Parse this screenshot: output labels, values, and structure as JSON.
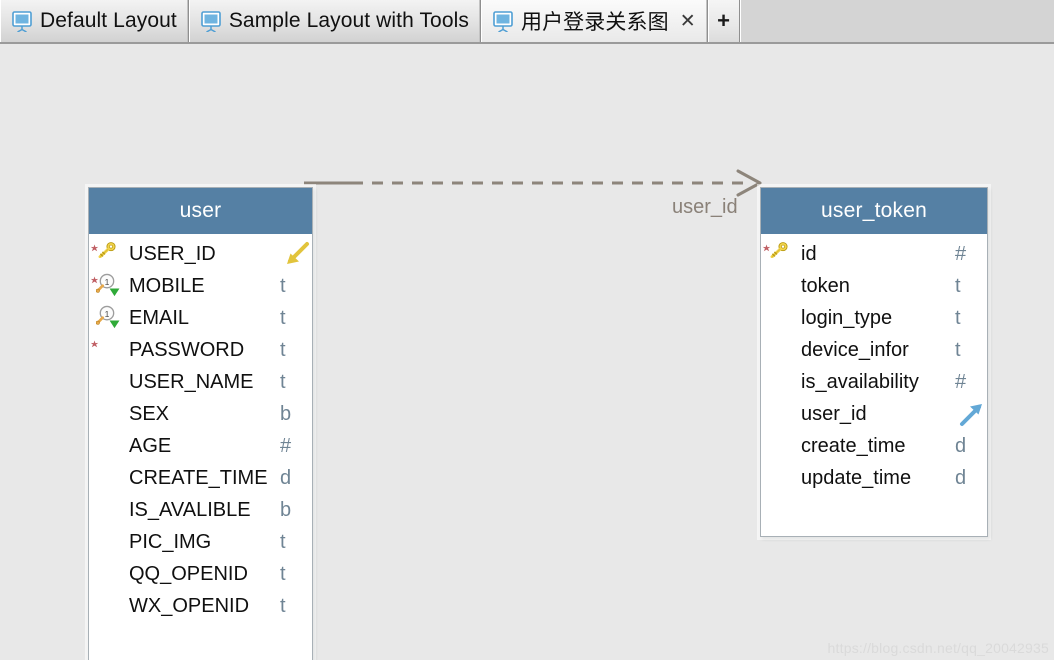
{
  "window": {
    "background_color": "#e8e8e8"
  },
  "tabbar": {
    "background_color": "#d4d4d4",
    "tabs": [
      {
        "label": "Default Layout",
        "icon": "monitor-icon",
        "active": false,
        "closable": false
      },
      {
        "label": "Sample Layout with Tools",
        "icon": "monitor-icon",
        "active": false,
        "closable": false
      },
      {
        "label": "用户登录关系图",
        "icon": "monitor-icon",
        "active": true,
        "closable": true,
        "close_glyph": "✕"
      }
    ],
    "add_tab_label": "+"
  },
  "diagram": {
    "header_color": "#5580a4",
    "body_color": "#ffffff",
    "entities": [
      {
        "name": "user",
        "columns": [
          {
            "name": "USER_ID",
            "type": "",
            "icons": [
              "required-star-icon",
              "primary-key-icon"
            ],
            "end_arrow": "fk-incoming-arrow-icon"
          },
          {
            "name": "MOBILE",
            "type": "t",
            "icons": [
              "required-star-icon",
              "unique-index-icon",
              "index-down-icon"
            ],
            "end_arrow": ""
          },
          {
            "name": "EMAIL",
            "type": "t",
            "icons": [
              "unique-index-icon",
              "index-down-icon"
            ],
            "end_arrow": ""
          },
          {
            "name": "PASSWORD",
            "type": "t",
            "icons": [
              "required-star-icon"
            ],
            "end_arrow": ""
          },
          {
            "name": "USER_NAME",
            "type": "t",
            "icons": [],
            "end_arrow": ""
          },
          {
            "name": "SEX",
            "type": "b",
            "icons": [],
            "end_arrow": ""
          },
          {
            "name": "AGE",
            "type": "#",
            "icons": [],
            "end_arrow": ""
          },
          {
            "name": "CREATE_TIME",
            "type": "d",
            "icons": [],
            "end_arrow": ""
          },
          {
            "name": "IS_AVALIBLE",
            "type": "b",
            "icons": [],
            "end_arrow": ""
          },
          {
            "name": "PIC_IMG",
            "type": "t",
            "icons": [],
            "end_arrow": ""
          },
          {
            "name": "QQ_OPENID",
            "type": "t",
            "icons": [],
            "end_arrow": ""
          },
          {
            "name": "WX_OPENID",
            "type": "t",
            "icons": [],
            "end_arrow": ""
          }
        ]
      },
      {
        "name": "user_token",
        "columns": [
          {
            "name": "id",
            "type": "#",
            "icons": [
              "required-star-icon",
              "primary-key-icon"
            ],
            "end_arrow": ""
          },
          {
            "name": "token",
            "type": "t",
            "icons": [],
            "end_arrow": ""
          },
          {
            "name": "login_type",
            "type": "t",
            "icons": [],
            "end_arrow": ""
          },
          {
            "name": "device_infor",
            "type": "t",
            "icons": [],
            "end_arrow": ""
          },
          {
            "name": "is_availability",
            "type": "#",
            "icons": [],
            "end_arrow": ""
          },
          {
            "name": "user_id",
            "type": "",
            "icons": [],
            "end_arrow": "fk-outgoing-arrow-icon"
          },
          {
            "name": "create_time",
            "type": "d",
            "icons": [],
            "end_arrow": ""
          },
          {
            "name": "update_time",
            "type": "d",
            "icons": [],
            "end_arrow": ""
          }
        ]
      }
    ],
    "relationship": {
      "label": "user_id",
      "line_color": "#8d857b",
      "style": "dashed"
    }
  },
  "watermark": {
    "text": "https://blog.csdn.net/qq_20042935"
  }
}
